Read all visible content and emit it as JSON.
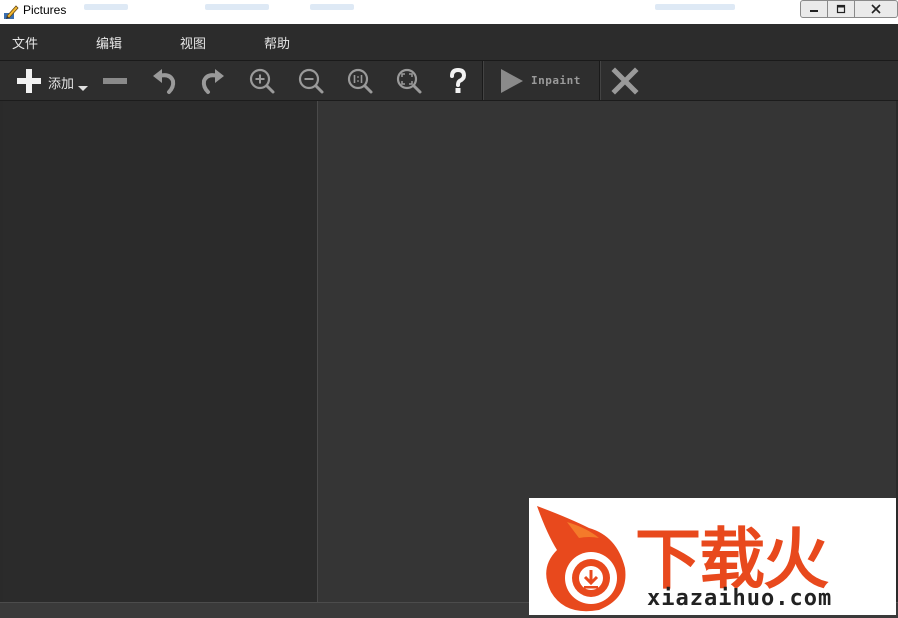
{
  "window": {
    "title": "Pictures",
    "app_icon": "pencil-app-icon"
  },
  "window_controls": {
    "minimize": "minimize-icon",
    "maximize": "maximize-icon",
    "close": "close-icon"
  },
  "menu": [
    {
      "label": "文件"
    },
    {
      "label": "编辑"
    },
    {
      "label": "视图"
    },
    {
      "label": "帮助"
    }
  ],
  "toolbar": {
    "add_label": "添加",
    "inpaint_label": "Inpaint",
    "icons": [
      "plus-icon",
      "minus-icon",
      "undo-icon",
      "redo-icon",
      "zoom-in-icon",
      "zoom-out-icon",
      "zoom-actual-icon",
      "zoom-fit-icon",
      "help-icon",
      "play-icon",
      "cancel-x-icon"
    ]
  },
  "watermark": {
    "text": "下载火",
    "url": "xiazaihuo.com",
    "color": "#e8491d"
  },
  "colors": {
    "background": "#2a2a2a",
    "canvas": "#353535",
    "icon": "#d0d0d0"
  }
}
